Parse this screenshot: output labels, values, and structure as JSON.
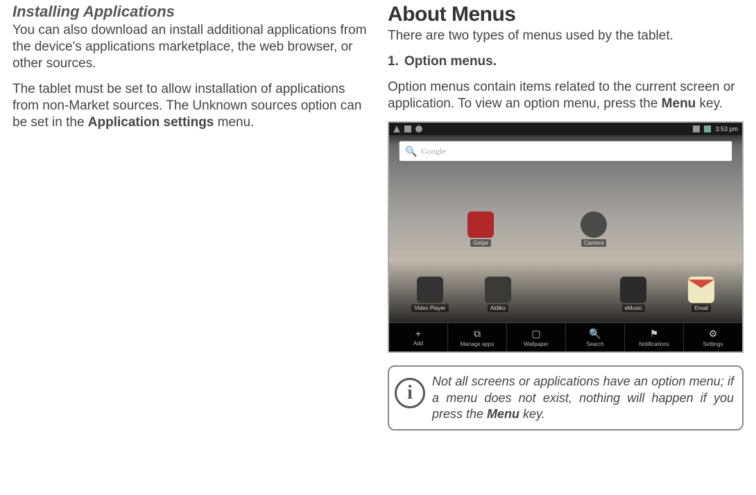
{
  "left": {
    "heading": "Installing Applications",
    "para1": "You can also download an install additional applications from the device's applications marketplace, the web browser, or other sources.",
    "para2_a": "The tablet must be set to allow installation of applications from non-Market sources. The Unknown sources option can be set in the ",
    "para2_bold": "Application settings",
    "para2_b": " menu."
  },
  "right": {
    "heading": "About Menus",
    "intro": "There are two types of menus used by the tablet.",
    "item_num": "1.",
    "item_label": "Option menus.",
    "para1_a": "Option menus contain items related to the current screen or application. To view an option menu, press the ",
    "para1_bold": "Menu",
    "para1_b": " key.",
    "info_a": "Not all screens or applications have an option menu; if a menu does not exist, nothing will happen if you press the ",
    "info_bold": "Menu",
    "info_b": " key."
  },
  "tablet": {
    "time": "3:53 pm",
    "search_logo": "Google",
    "apps_row1": [
      {
        "label": "Getjar",
        "icon": "icon-getjar"
      },
      {
        "label": "Camera",
        "icon": "icon-camera"
      }
    ],
    "apps_row2": [
      {
        "label": "Video Player",
        "icon": "icon-video"
      },
      {
        "label": "Aldiko",
        "icon": "icon-aldiko"
      },
      {
        "label": "eMusic",
        "icon": "icon-emusic"
      },
      {
        "label": "Email",
        "icon": "icon-email"
      }
    ],
    "dock": [
      {
        "label": "Add",
        "glyph": "+"
      },
      {
        "label": "Manage apps",
        "glyph": "⧉"
      },
      {
        "label": "Wallpaper",
        "glyph": "▢"
      },
      {
        "label": "Search",
        "glyph": "🔍"
      },
      {
        "label": "Notifications",
        "glyph": "⚑"
      },
      {
        "label": "Settings",
        "glyph": "⚙"
      }
    ]
  }
}
